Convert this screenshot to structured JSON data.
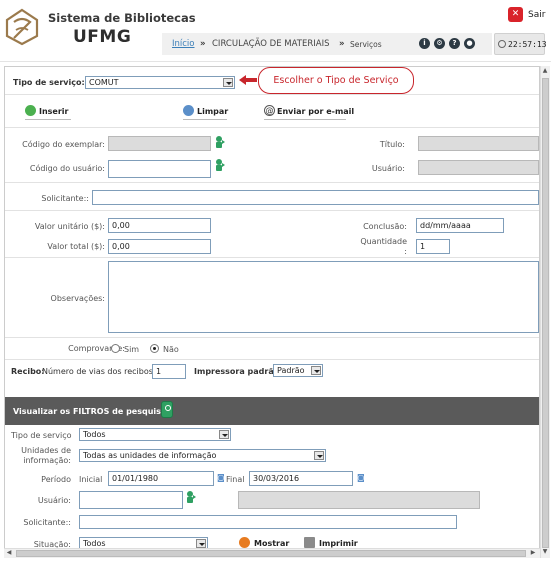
{
  "header": {
    "brand_line1": "Sistema de Bibliotecas",
    "brand_line2": "UFMG",
    "sair_label": "Sair",
    "breadcrumb": {
      "home": "Início",
      "sep1": "»",
      "section": "CIRCULAÇÃO DE MATERIAIS",
      "sep2": "»",
      "page": "Serviços"
    },
    "clock": "22:57:13"
  },
  "annotation": "Escolher o Tipo de Serviço",
  "form": {
    "tipo_servico_label": "Tipo de serviço:",
    "tipo_servico_value": "COMUT",
    "toolbar": {
      "inserir": "Inserir",
      "limpar": "Limpar",
      "enviar": "Enviar por e-mail"
    },
    "codigo_exemplar_label": "Código do exemplar:",
    "titulo_label": "Título:",
    "codigo_usuario_label": "Código do usuário:",
    "usuario_label": "Usuário:",
    "solicitante_label": "Solicitante::",
    "valor_unitario_label": "Valor unitário ($):",
    "valor_unitario_value": "0,00",
    "conclusao_label": "Conclusão:",
    "conclusao_value": "dd/mm/aaaa",
    "valor_total_label": "Valor total ($):",
    "valor_total_value": "0,00",
    "quantidade_label_1": "Quantidade",
    "quantidade_label_2": ":",
    "quantidade_value": "1",
    "observacoes_label": "Observações:",
    "comprovante_label": "Comprovante:",
    "comprovante_sim": "Sim",
    "comprovante_nao": "Não",
    "comprovante_selected": "Não",
    "recibo_label": "Recibo:",
    "num_vias_label": "Número de vias dos recibos",
    "num_vias_value": "1",
    "impressora_label": "Impressora padrão:",
    "impressora_value": "Padrão"
  },
  "filters": {
    "title": "Visualizar os FILTROS de pesquisa:",
    "tipo_servico_label": "Tipo de serviço",
    "tipo_servico_value": "Todos",
    "unidades_label_1": "Unidades de",
    "unidades_label_2": "informação:",
    "unidades_value": "Todas as unidades de informação",
    "periodo_label": "Período",
    "inicial_label": "Inicial",
    "inicial_value": "01/01/1980",
    "final_label": "Final",
    "final_value": "30/03/2016",
    "usuario_label": "Usuário:",
    "solicitante_label": "Solicitante::",
    "situacao_label": "Situação:",
    "situacao_value": "Todos",
    "mostrar": "Mostrar",
    "imprimir": "Imprimir"
  },
  "colors": {
    "accent_red": "#c8262c",
    "link_blue": "#3c7fb8",
    "filter_bar": "#5a5a5a",
    "green_icon": "#2fa062"
  }
}
